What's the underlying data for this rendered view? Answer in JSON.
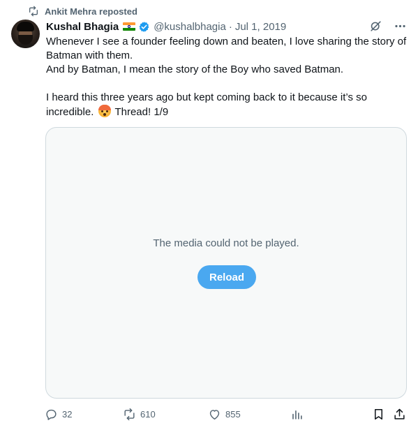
{
  "repost": {
    "icon": "repost-icon",
    "text": "Ankit Mehra reposted"
  },
  "author": {
    "name": "Kushal Bhagia",
    "flag": "india-flag-icon",
    "verified": "verified-badge-icon",
    "handle": "@kushalbhagia",
    "separator": "·",
    "date": "Jul 1, 2019"
  },
  "top_icons": [
    "grok-icon",
    "more-icon"
  ],
  "tweet": {
    "line1": "Whenever I see a founder feeling down and beaten, I love sharing the story of Batman with them.",
    "line2": "And by Batman, I mean the story of the Boy who saved Batman.",
    "line3_start": "I heard this three years ago but kept coming back to it because it’s so incredible.",
    "line3_end": "Thread!  1/9",
    "emoji": "exploding-head-emoji"
  },
  "media": {
    "message": "The media could not be played.",
    "reload_label": "Reload"
  },
  "actions": {
    "replies": "32",
    "reposts": "610",
    "likes": "855"
  },
  "colors": {
    "text": "#0f1419",
    "muted": "#536471",
    "accent": "#1d9bf0",
    "reload_bg": "#4aa8f0",
    "border": "#cfd9de"
  }
}
